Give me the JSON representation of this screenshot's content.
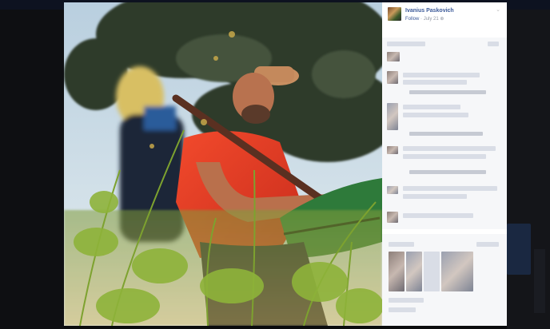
{
  "post": {
    "author": "Ivanius Paskovich",
    "follow_label": "Follow",
    "separator": "·",
    "date": "July 21",
    "globe": "⊕",
    "chevron": "⌄"
  },
  "colors": {
    "link": "#3b5998",
    "meta": "#9197a3",
    "panel_bg": "#f6f7f9",
    "backdrop": "#0b0c0e"
  },
  "photo": {
    "icon": "photo-of-hiker-in-grass"
  }
}
